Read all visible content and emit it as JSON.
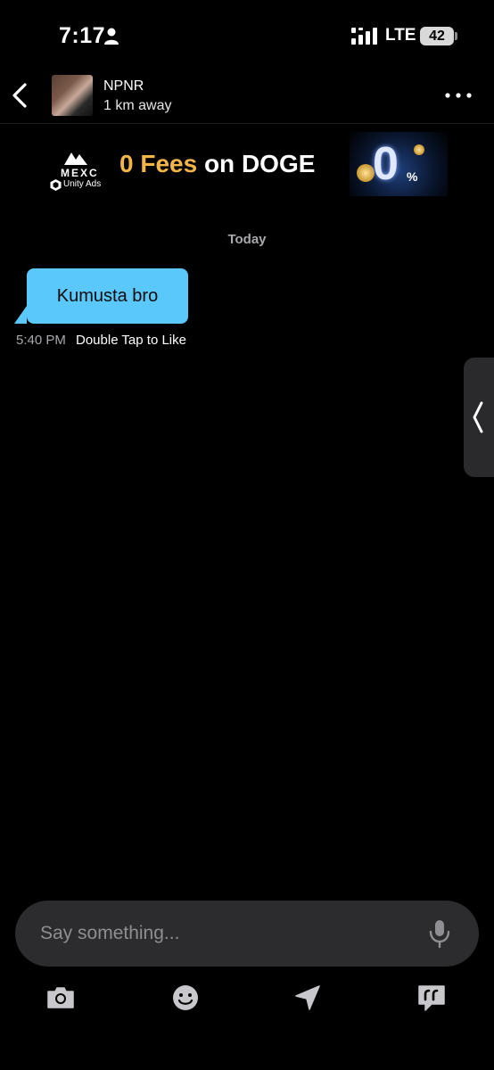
{
  "status_bar": {
    "time": "7:17",
    "network": "LTE",
    "battery": "42"
  },
  "header": {
    "contact_name": "NPNR",
    "distance": "1 km away"
  },
  "ad": {
    "brand": "MEXC",
    "network": "Unity Ads",
    "headline_accent": "0 Fees",
    "headline_main": " on DOGE",
    "art_zero": "0",
    "art_pct": "%"
  },
  "chat": {
    "date_divider": "Today",
    "messages": [
      {
        "text": "Kumusta bro",
        "time": "5:40 PM",
        "action": "Double Tap to Like"
      }
    ]
  },
  "composer": {
    "placeholder": "Say something..."
  },
  "toolbar": {
    "items": [
      "camera-icon",
      "emoji-icon",
      "location-icon",
      "quick-replies-icon"
    ]
  },
  "colors": {
    "background": "#000000",
    "bubble": "#5ac8fa",
    "input_bg": "#2c2c2e",
    "ad_accent": "#f3b548"
  }
}
